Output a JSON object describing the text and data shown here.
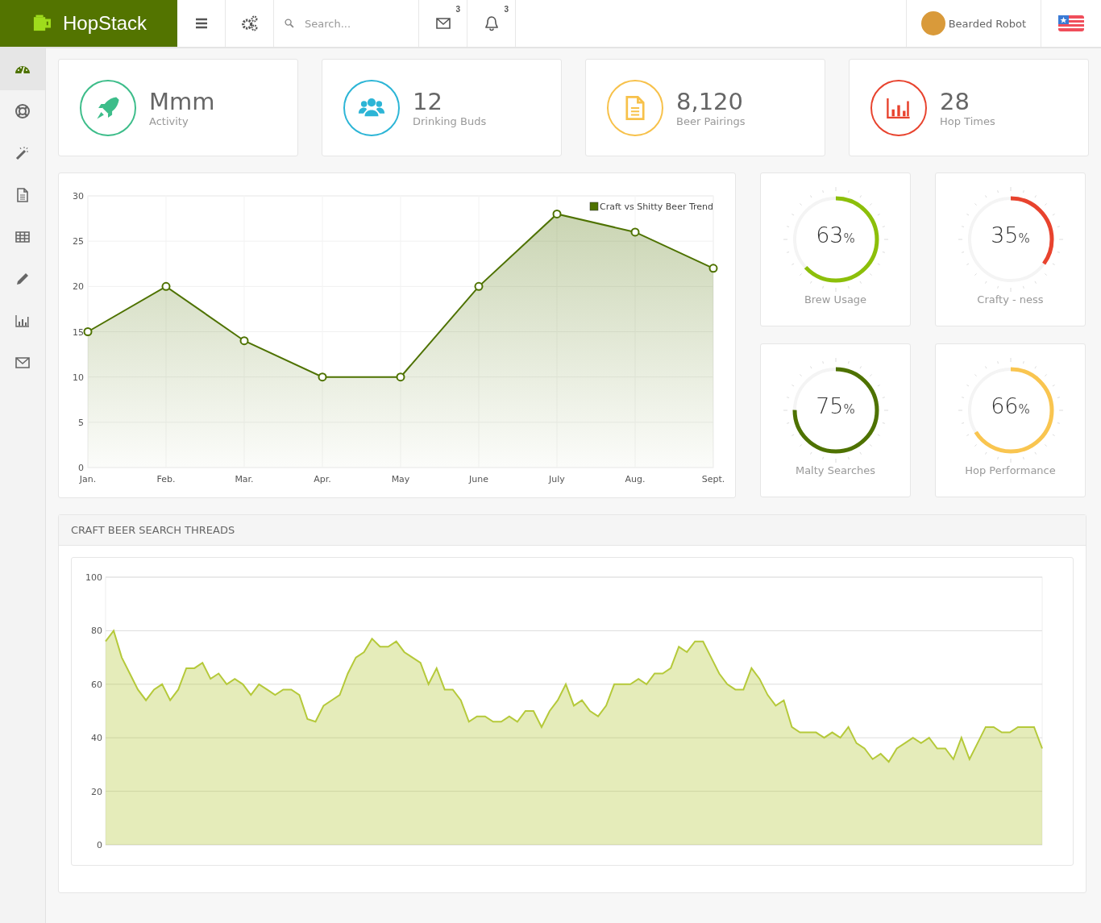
{
  "brand": {
    "name": "HopStack"
  },
  "topbar": {
    "search": {
      "placeholder": "Search..."
    },
    "messages": {
      "count": "3"
    },
    "notifications": {
      "count": "3"
    },
    "user": {
      "name": "Bearded Robot"
    }
  },
  "sidebar": {
    "items": [
      {
        "kind": "dashboard",
        "selected": true
      },
      {
        "kind": "lifebuoy",
        "selected": false
      },
      {
        "kind": "wand",
        "selected": false
      },
      {
        "kind": "document",
        "selected": false
      },
      {
        "kind": "table",
        "selected": false
      },
      {
        "kind": "pencil",
        "selected": false
      },
      {
        "kind": "chart",
        "selected": false
      },
      {
        "kind": "mail",
        "selected": false
      }
    ]
  },
  "stats": [
    {
      "kind": "rocket",
      "color": "#3dbd8a",
      "value": "Mmm",
      "label": "Activity"
    },
    {
      "kind": "users",
      "color": "#2cb5d6",
      "value": "12",
      "label": "Drinking Buds"
    },
    {
      "kind": "document",
      "color": "#f7c14a",
      "value": "8,120",
      "label": "Beer Pairings"
    },
    {
      "kind": "chart",
      "color": "#e8432e",
      "value": "28",
      "label": "Hop Times"
    }
  ],
  "trend": {
    "chart_data": {
      "type": "area",
      "grid": true,
      "categories": [
        "Jan.",
        "Feb.",
        "Mar.",
        "Apr.",
        "May",
        "June",
        "July",
        "Aug.",
        "Sept."
      ],
      "ylim": [
        0,
        30
      ],
      "yticks": [
        0,
        5,
        10,
        15,
        20,
        25,
        30
      ],
      "series": [
        {
          "name": "Craft vs Shitty Beer Trend",
          "color": "#4e7200",
          "values": [
            15,
            20,
            14,
            10,
            10,
            20,
            28,
            26,
            22
          ]
        }
      ]
    }
  },
  "gauges": [
    {
      "label": "Brew Usage",
      "value": "63",
      "unit": "%",
      "level": 0.63,
      "color": "#8cbf0a"
    },
    {
      "label": "Crafty - ness",
      "value": "35",
      "unit": "%",
      "level": 0.35,
      "color": "#e8432e"
    },
    {
      "label": "Malty Searches",
      "value": "75",
      "unit": "%",
      "level": 0.75,
      "color": "#4e7200"
    },
    {
      "label": "Hop Performance",
      "value": "66",
      "unit": "%",
      "level": 0.66,
      "color": "#f9c550"
    }
  ],
  "threads": {
    "title": "CRAFT BEER SEARCH THREADS",
    "chart_data": {
      "type": "area",
      "grid": true,
      "ylim": [
        0,
        100
      ],
      "yticks": [
        0,
        20,
        40,
        60,
        80,
        100
      ],
      "series": [
        {
          "color": "#b5c93a",
          "values": [
            76,
            80,
            70,
            64,
            58,
            54,
            58,
            60,
            54,
            58,
            66,
            66,
            68,
            62,
            64,
            60,
            62,
            60,
            56,
            60,
            58,
            56,
            58,
            58,
            56,
            47,
            46,
            52,
            54,
            56,
            64,
            70,
            72,
            77,
            74,
            74,
            76,
            72,
            70,
            68,
            60,
            66,
            58,
            58,
            54,
            46,
            48,
            48,
            46,
            46,
            48,
            46,
            50,
            50,
            44,
            50,
            54,
            60,
            52,
            54,
            50,
            48,
            52,
            60,
            60,
            60,
            62,
            60,
            64,
            64,
            66,
            74,
            72,
            76,
            76,
            70,
            64,
            60,
            58,
            58,
            66,
            62,
            56,
            52,
            54,
            44,
            42,
            42,
            42,
            40,
            42,
            40,
            44,
            38,
            36,
            32,
            34,
            31,
            36,
            38,
            40,
            38,
            40,
            36,
            36,
            32,
            40,
            32,
            38,
            44,
            44,
            42,
            42,
            44,
            44,
            44,
            36
          ]
        }
      ]
    }
  }
}
